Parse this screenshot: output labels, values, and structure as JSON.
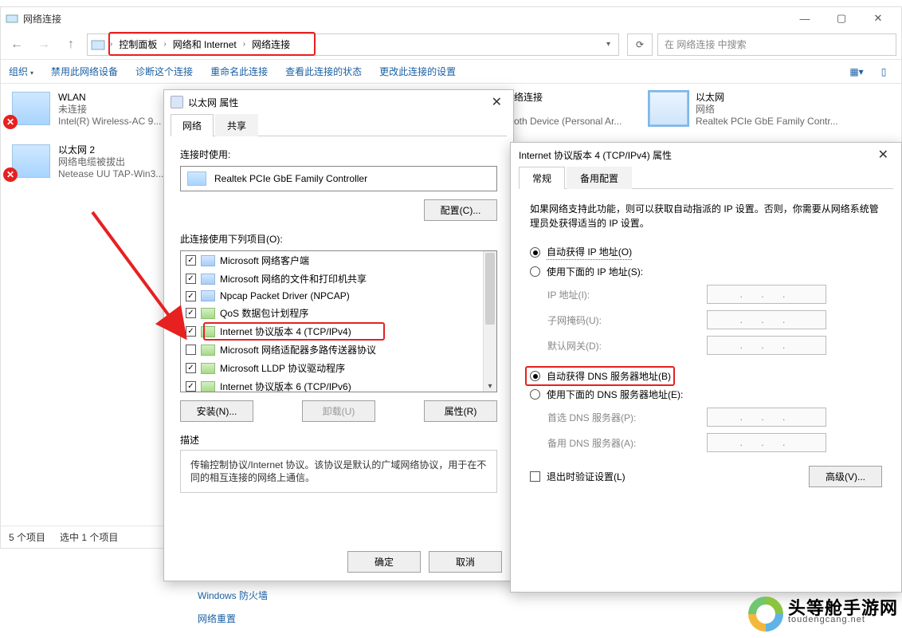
{
  "artifact_text": "— — —",
  "explorer": {
    "title": "网络连接",
    "window_buttons": {
      "min": "—",
      "max": "▢",
      "close": "✕"
    },
    "breadcrumb": [
      "控制面板",
      "网络和 Internet",
      "网络连接"
    ],
    "refresh_icon": "⟳",
    "search_placeholder": "在 网络连接 中搜索",
    "toolbar": {
      "organize": "组织",
      "disable": "禁用此网络设备",
      "diagnose": "诊断这个连接",
      "rename": "重命名此连接",
      "status": "查看此连接的状态",
      "change": "更改此连接的设置"
    },
    "adapters": [
      {
        "name": "WLAN",
        "status": "未连接",
        "device": "Intel(R) Wireless-AC 9...",
        "error": true
      },
      {
        "name": "以太网 2",
        "status": "网络电缆被拔出",
        "device": "Netease UU TAP-Win3...",
        "error": true
      },
      {
        "name": "络连接",
        "status": "",
        "device": "oth Device (Personal Ar...",
        "error": false
      },
      {
        "name": "以太网",
        "status": "网络",
        "device": "Realtek PCIe GbE Family Contr...",
        "error": false,
        "selected": true
      }
    ],
    "statusbar": {
      "count": "5 个项目",
      "selected": "选中 1 个项目"
    }
  },
  "links": {
    "firewall": "Windows 防火墙",
    "reset": "网络重置"
  },
  "dlg1": {
    "title": "以太网 属性",
    "tabs": [
      "网络",
      "共享"
    ],
    "connect_using": "连接时使用:",
    "adapter_name": "Realtek PCIe GbE Family Controller",
    "configure": "配置(C)...",
    "items_label": "此连接使用下列项目(O):",
    "items": [
      {
        "label": "Microsoft 网络客户端",
        "checked": true,
        "icon": "mon"
      },
      {
        "label": "Microsoft 网络的文件和打印机共享",
        "checked": true,
        "icon": "mon"
      },
      {
        "label": "Npcap Packet Driver (NPCAP)",
        "checked": true,
        "icon": "mon"
      },
      {
        "label": "QoS 数据包计划程序",
        "checked": true,
        "icon": "net"
      },
      {
        "label": "Internet 协议版本 4 (TCP/IPv4)",
        "checked": true,
        "icon": "net",
        "highlight": true
      },
      {
        "label": "Microsoft 网络适配器多路传送器协议",
        "checked": false,
        "icon": "net"
      },
      {
        "label": "Microsoft LLDP 协议驱动程序",
        "checked": true,
        "icon": "net"
      },
      {
        "label": "Internet 协议版本 6 (TCP/IPv6)",
        "checked": true,
        "icon": "net"
      }
    ],
    "install": "安装(N)...",
    "uninstall": "卸载(U)",
    "properties": "属性(R)",
    "desc_label": "描述",
    "desc_text": "传输控制协议/Internet 协议。该协议是默认的广域网络协议，用于在不同的相互连接的网络上通信。",
    "ok": "确定",
    "cancel": "取消"
  },
  "dlg2": {
    "title": "Internet 协议版本 4 (TCP/IPv4) 属性",
    "tabs": [
      "常规",
      "备用配置"
    ],
    "info": "如果网络支持此功能，则可以获取自动指派的 IP 设置。否则，你需要从网络系统管理员处获得适当的 IP 设置。",
    "ip_auto": "自动获得 IP 地址(O)",
    "ip_manual": "使用下面的 IP 地址(S):",
    "ip_label": "IP 地址(I):",
    "mask_label": "子网掩码(U):",
    "gw_label": "默认网关(D):",
    "dns_auto": "自动获得 DNS 服务器地址(B)",
    "dns_manual": "使用下面的 DNS 服务器地址(E):",
    "dns1_label": "首选 DNS 服务器(P):",
    "dns2_label": "备用 DNS 服务器(A):",
    "validate": "退出时验证设置(L)",
    "advanced": "高级(V)...",
    "ip_placeholder": ". . ."
  },
  "watermark": {
    "big": "头等舱手游网",
    "small": "toudengcang.net"
  }
}
